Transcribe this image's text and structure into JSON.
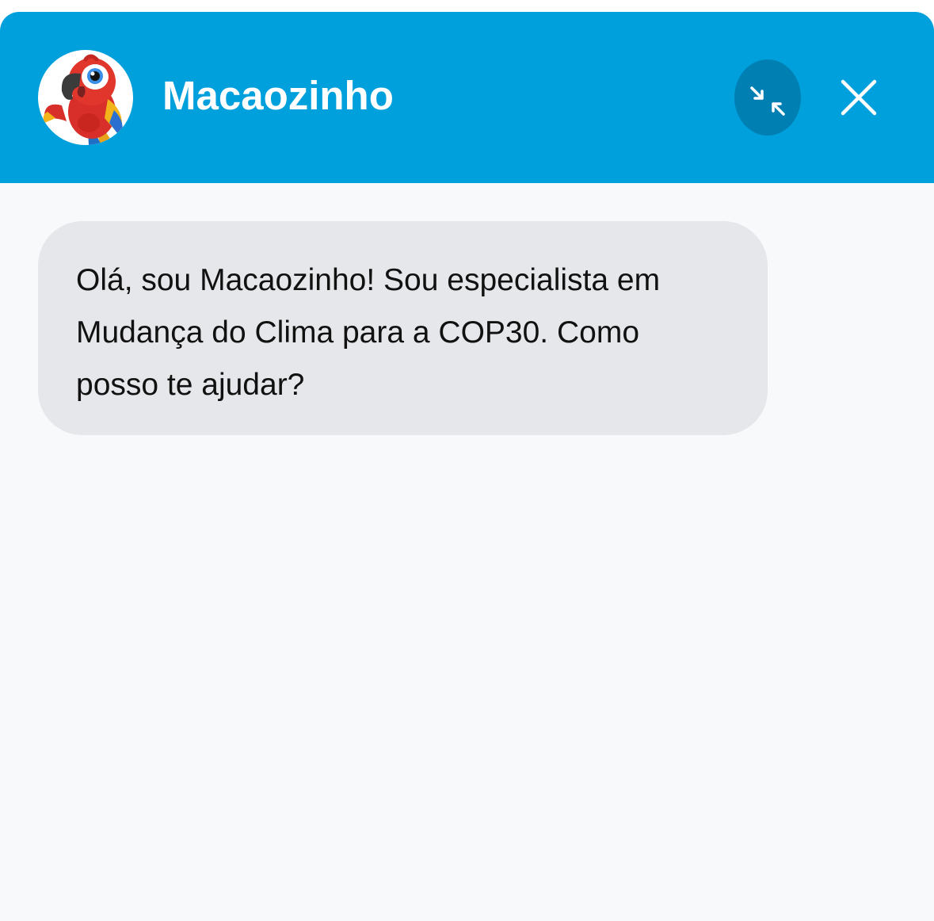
{
  "header": {
    "bot_name": "Macaozinho",
    "avatar_icon": "parrot-mascot-icon",
    "minimize_icon": "minimize-arrows-icon",
    "close_icon": "close-icon",
    "background_color": "#00a0dc",
    "minimize_bg_color": "#007fb3"
  },
  "messages": [
    {
      "sender": "bot",
      "text": "Olá, sou Macaozinho! Sou especialista em Mudança do Clima para a COP30. Como posso te ajudar?"
    }
  ],
  "colors": {
    "chat_background": "#f8f9fb",
    "bubble_background": "#e6e7ea",
    "text": "#111111"
  }
}
